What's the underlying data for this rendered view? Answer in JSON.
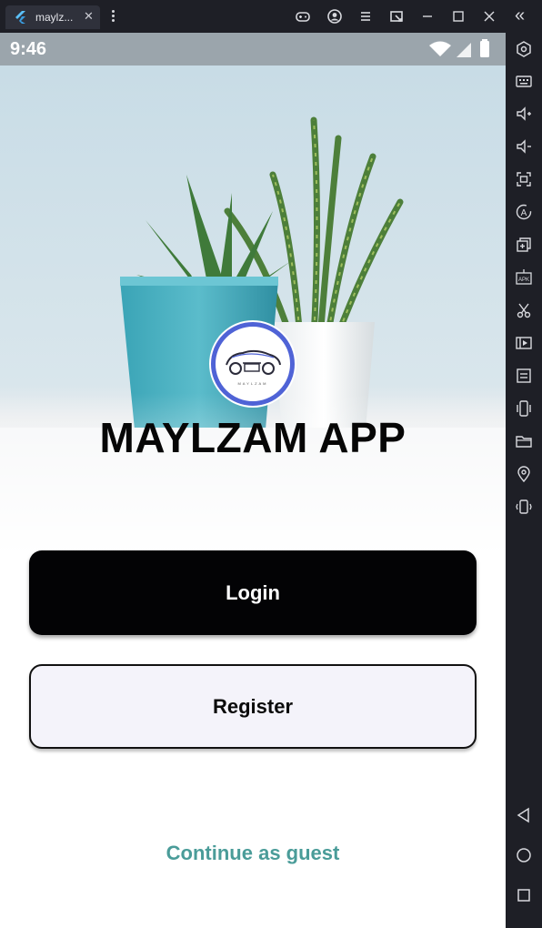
{
  "emulator": {
    "tab_title": "maylz...",
    "tab_close": "✕",
    "toolbar_icons": [
      "gamepad-icon",
      "account-icon",
      "menu-icon",
      "screen-share-icon",
      "minimize-icon",
      "maximize-icon",
      "close-icon"
    ],
    "collapse_glyph": "«",
    "sidebar_icons": [
      "settings-hex-icon",
      "keyboard-icon",
      "volume-up-icon",
      "volume-down-icon",
      "screenshot-icon",
      "auto-rotate-icon",
      "multi-instance-icon",
      "apk-icon",
      "scissors-icon",
      "video-record-icon",
      "sync-icon",
      "shake-icon",
      "folder-icon",
      "location-icon",
      "vibrate-icon"
    ],
    "nav_icons": [
      "back-icon",
      "home-icon",
      "recents-icon"
    ]
  },
  "statusbar": {
    "time": "9:46"
  },
  "app": {
    "title": "MAYLZAM APP",
    "logo_text": "MAYLZAM",
    "login_label": "Login",
    "register_label": "Register",
    "guest_label": "Continue as guest"
  },
  "colors": {
    "accent_guest": "#4a9c99",
    "logo_ring": "#4f63d6",
    "login_bg": "#030305",
    "register_bg": "#f4f3fa"
  }
}
